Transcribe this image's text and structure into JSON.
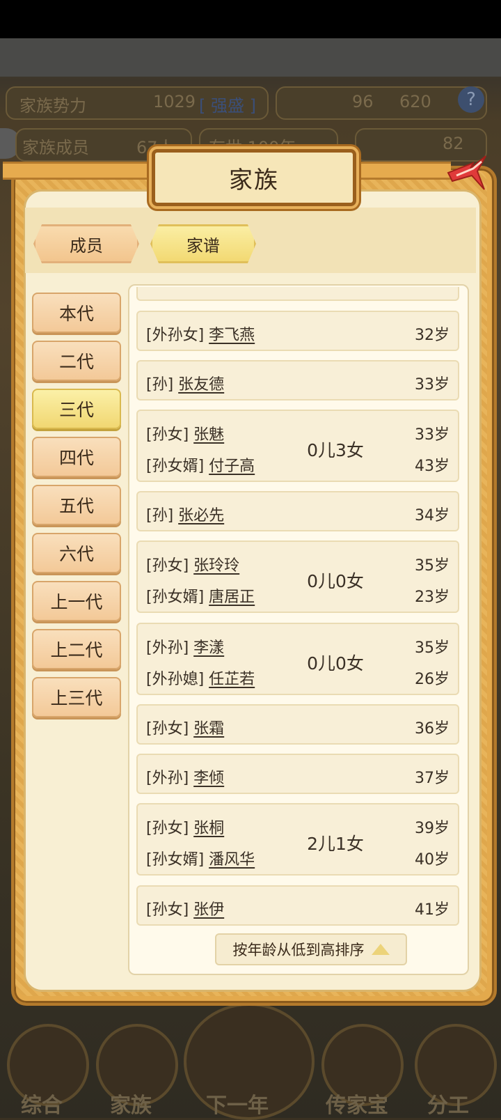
{
  "background": {
    "power_label": "家族势力",
    "power_value": "1029",
    "power_tag": "[ 强盛 ]",
    "coins": "96",
    "coins2": "620",
    "members_label": "家族成员",
    "members_value": "67人",
    "exist_label": "存世 100年",
    "gold": "82",
    "nav": [
      "综合",
      "家族",
      "下一年",
      "传家宝",
      "分工"
    ]
  },
  "modal": {
    "title": "家族",
    "tabs": [
      {
        "label": "成员",
        "active": false
      },
      {
        "label": "家谱",
        "active": true
      }
    ],
    "generations": [
      {
        "label": "本代",
        "active": false
      },
      {
        "label": "二代",
        "active": false
      },
      {
        "label": "三代",
        "active": true
      },
      {
        "label": "四代",
        "active": false
      },
      {
        "label": "五代",
        "active": false
      },
      {
        "label": "六代",
        "active": false
      },
      {
        "label": "上一代",
        "active": false
      },
      {
        "label": "上二代",
        "active": false
      },
      {
        "label": "上三代",
        "active": false
      }
    ],
    "members": [
      {
        "role": "[外孙女]",
        "name": "李飞燕",
        "age": "32岁"
      },
      {
        "role": "[孙]",
        "name": "张友德",
        "age": "33岁"
      },
      {
        "role": "[孙女]",
        "name": "张魅",
        "age": "33岁",
        "spouse_role": "[孙女婿]",
        "spouse_name": "付子高",
        "spouse_age": "43岁",
        "children": "0儿3女"
      },
      {
        "role": "[孙]",
        "name": "张必先",
        "age": "34岁"
      },
      {
        "role": "[孙女]",
        "name": "张玲玲",
        "age": "35岁",
        "spouse_role": "[孙女婿]",
        "spouse_name": "唐居正",
        "spouse_age": "23岁",
        "children": "0儿0女"
      },
      {
        "role": "[外孙]",
        "name": "李漾",
        "age": "35岁",
        "spouse_role": "[外孙媳]",
        "spouse_name": "任芷若",
        "spouse_age": "26岁",
        "children": "0儿0女"
      },
      {
        "role": "[孙女]",
        "name": "张霜",
        "age": "36岁"
      },
      {
        "role": "[外孙]",
        "name": "李倾",
        "age": "37岁"
      },
      {
        "role": "[孙女]",
        "name": "张桐",
        "age": "39岁",
        "spouse_role": "[孙女婿]",
        "spouse_name": "潘风华",
        "spouse_age": "40岁",
        "children": "2儿1女"
      },
      {
        "role": "[孙女]",
        "name": "张伊",
        "age": "41岁"
      }
    ],
    "sort_label": "按年龄从低到高排序"
  }
}
